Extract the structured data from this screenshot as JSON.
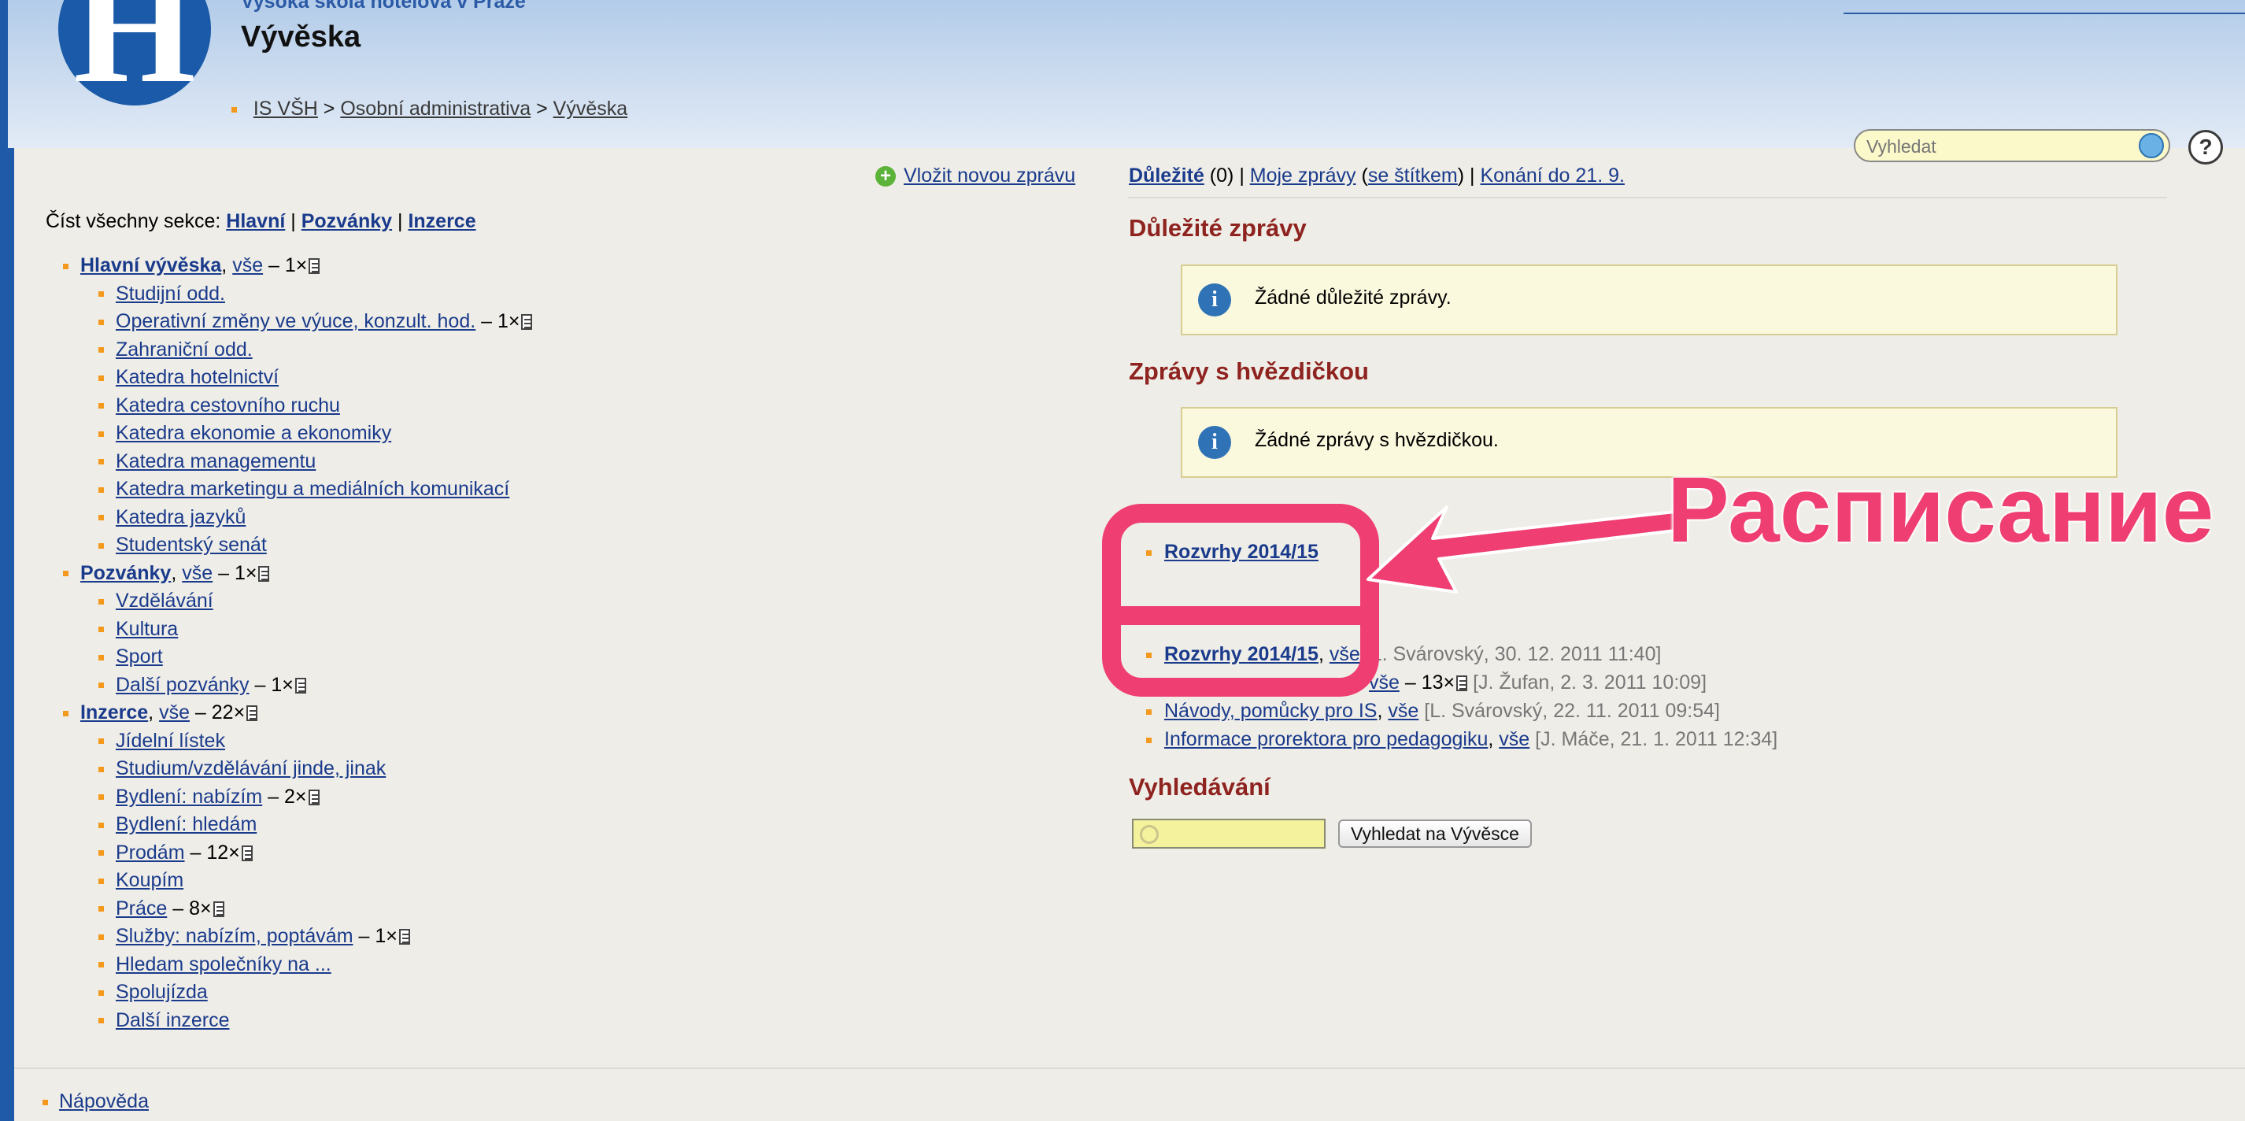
{
  "header": {
    "logo_letter": "H",
    "school_name": "Vysoká škola hotelová v Praze",
    "page_title": "Vývěska",
    "breadcrumb": [
      "IS VŠH",
      "Osobní administrativa",
      "Vývěska"
    ],
    "breadcrumb_sep": ">",
    "search_placeholder": "Vyhledat",
    "help_label": "?"
  },
  "left": {
    "new_message": "Vložit novou zprávu",
    "read_all_label": "Číst všechny sekce:",
    "read_all_links": [
      "Hlavní",
      "Pozvánky",
      "Inzerce"
    ],
    "sep": "|",
    "sections": [
      {
        "name": "Hlavní vývěska",
        "all": "vše",
        "count": " – 1×",
        "items": [
          {
            "label": "Studijní odd.",
            "count": ""
          },
          {
            "label": "Operativní změny ve výuce, konzult. hod.",
            "count": " – 1×"
          },
          {
            "label": "Zahraniční odd.",
            "count": ""
          },
          {
            "label": "Katedra hotelnictví",
            "count": ""
          },
          {
            "label": "Katedra cestovního ruchu",
            "count": ""
          },
          {
            "label": "Katedra ekonomie a ekonomiky",
            "count": ""
          },
          {
            "label": "Katedra managementu",
            "count": ""
          },
          {
            "label": "Katedra marketingu a mediálních komunikací",
            "count": ""
          },
          {
            "label": "Katedra jazyků",
            "count": ""
          },
          {
            "label": "Studentský senát",
            "count": ""
          }
        ]
      },
      {
        "name": "Pozvánky",
        "all": "vše",
        "count": " – 1×",
        "items": [
          {
            "label": "Vzdělávání",
            "count": ""
          },
          {
            "label": "Kultura",
            "count": ""
          },
          {
            "label": "Sport",
            "count": ""
          },
          {
            "label": "Další pozvánky",
            "count": " – 1×"
          }
        ]
      },
      {
        "name": "Inzerce",
        "all": "vše",
        "count": " – 22×",
        "items": [
          {
            "label": "Jídelní lístek",
            "count": ""
          },
          {
            "label": "Studium/vzdělávání jinde, jinak",
            "count": ""
          },
          {
            "label": "Bydlení: nabízím",
            "count": " – 2×"
          },
          {
            "label": "Bydlení: hledám",
            "count": ""
          },
          {
            "label": "Prodám",
            "count": " – 12×"
          },
          {
            "label": "Koupím",
            "count": ""
          },
          {
            "label": "Práce",
            "count": " – 8×"
          },
          {
            "label": "Služby: nabízím, poptávám",
            "count": " – 1×"
          },
          {
            "label": "Hledam společníky na ...",
            "count": ""
          },
          {
            "label": "Spolujízda",
            "count": ""
          },
          {
            "label": "Další inzerce",
            "count": ""
          }
        ]
      }
    ],
    "footer_help": "Nápověda"
  },
  "right": {
    "nav": {
      "important": "Důležité",
      "important_count": " (0) ",
      "sep": "|",
      "my_messages": "Moje zprávy",
      "with_tag": "se štítkem",
      "events": "Konání do 21. 9."
    },
    "important_title": "Důležité zprávy",
    "important_empty": "Žádné důležité zprávy.",
    "starred_title": "Zprávy s hvězdičkou",
    "starred_empty": "Žádné zprávy s hvězdičkou.",
    "sticky_top": {
      "label": "Rozvrhy 2014/15"
    },
    "sticky_items": [
      {
        "label": "Rozvrhy 2014/15",
        "all": "vše",
        "count": "",
        "meta": "[L. Svárovský, 30. 12. 2011 11:40]",
        "bold": true
      },
      {
        "label": "",
        "all": "vše",
        "count": " – 13×",
        "meta": "[J. Žufan, 2. 3. 2011 10:09]",
        "bold": false
      },
      {
        "label": "Návody, pomůcky pro IS",
        "all": "vše",
        "count": "",
        "meta": "[L. Svárovský, 22. 11. 2011 09:54]",
        "bold": false
      },
      {
        "label": "Informace prorektora pro pedagogiku",
        "all": "vše",
        "count": "",
        "meta": "[J. Máče, 21. 1. 2011 12:34]",
        "bold": false
      }
    ],
    "search_title": "Vyhledávání",
    "search_button": "Vyhledat na Vývěsce"
  },
  "annotation": {
    "text": "Расписание",
    "color": "#ef3e72"
  },
  "colors": {
    "bullet": "#f39a1e",
    "section_title": "#8e231f",
    "link": "#1a3b8c",
    "header_blue": "#1f5aa8"
  }
}
